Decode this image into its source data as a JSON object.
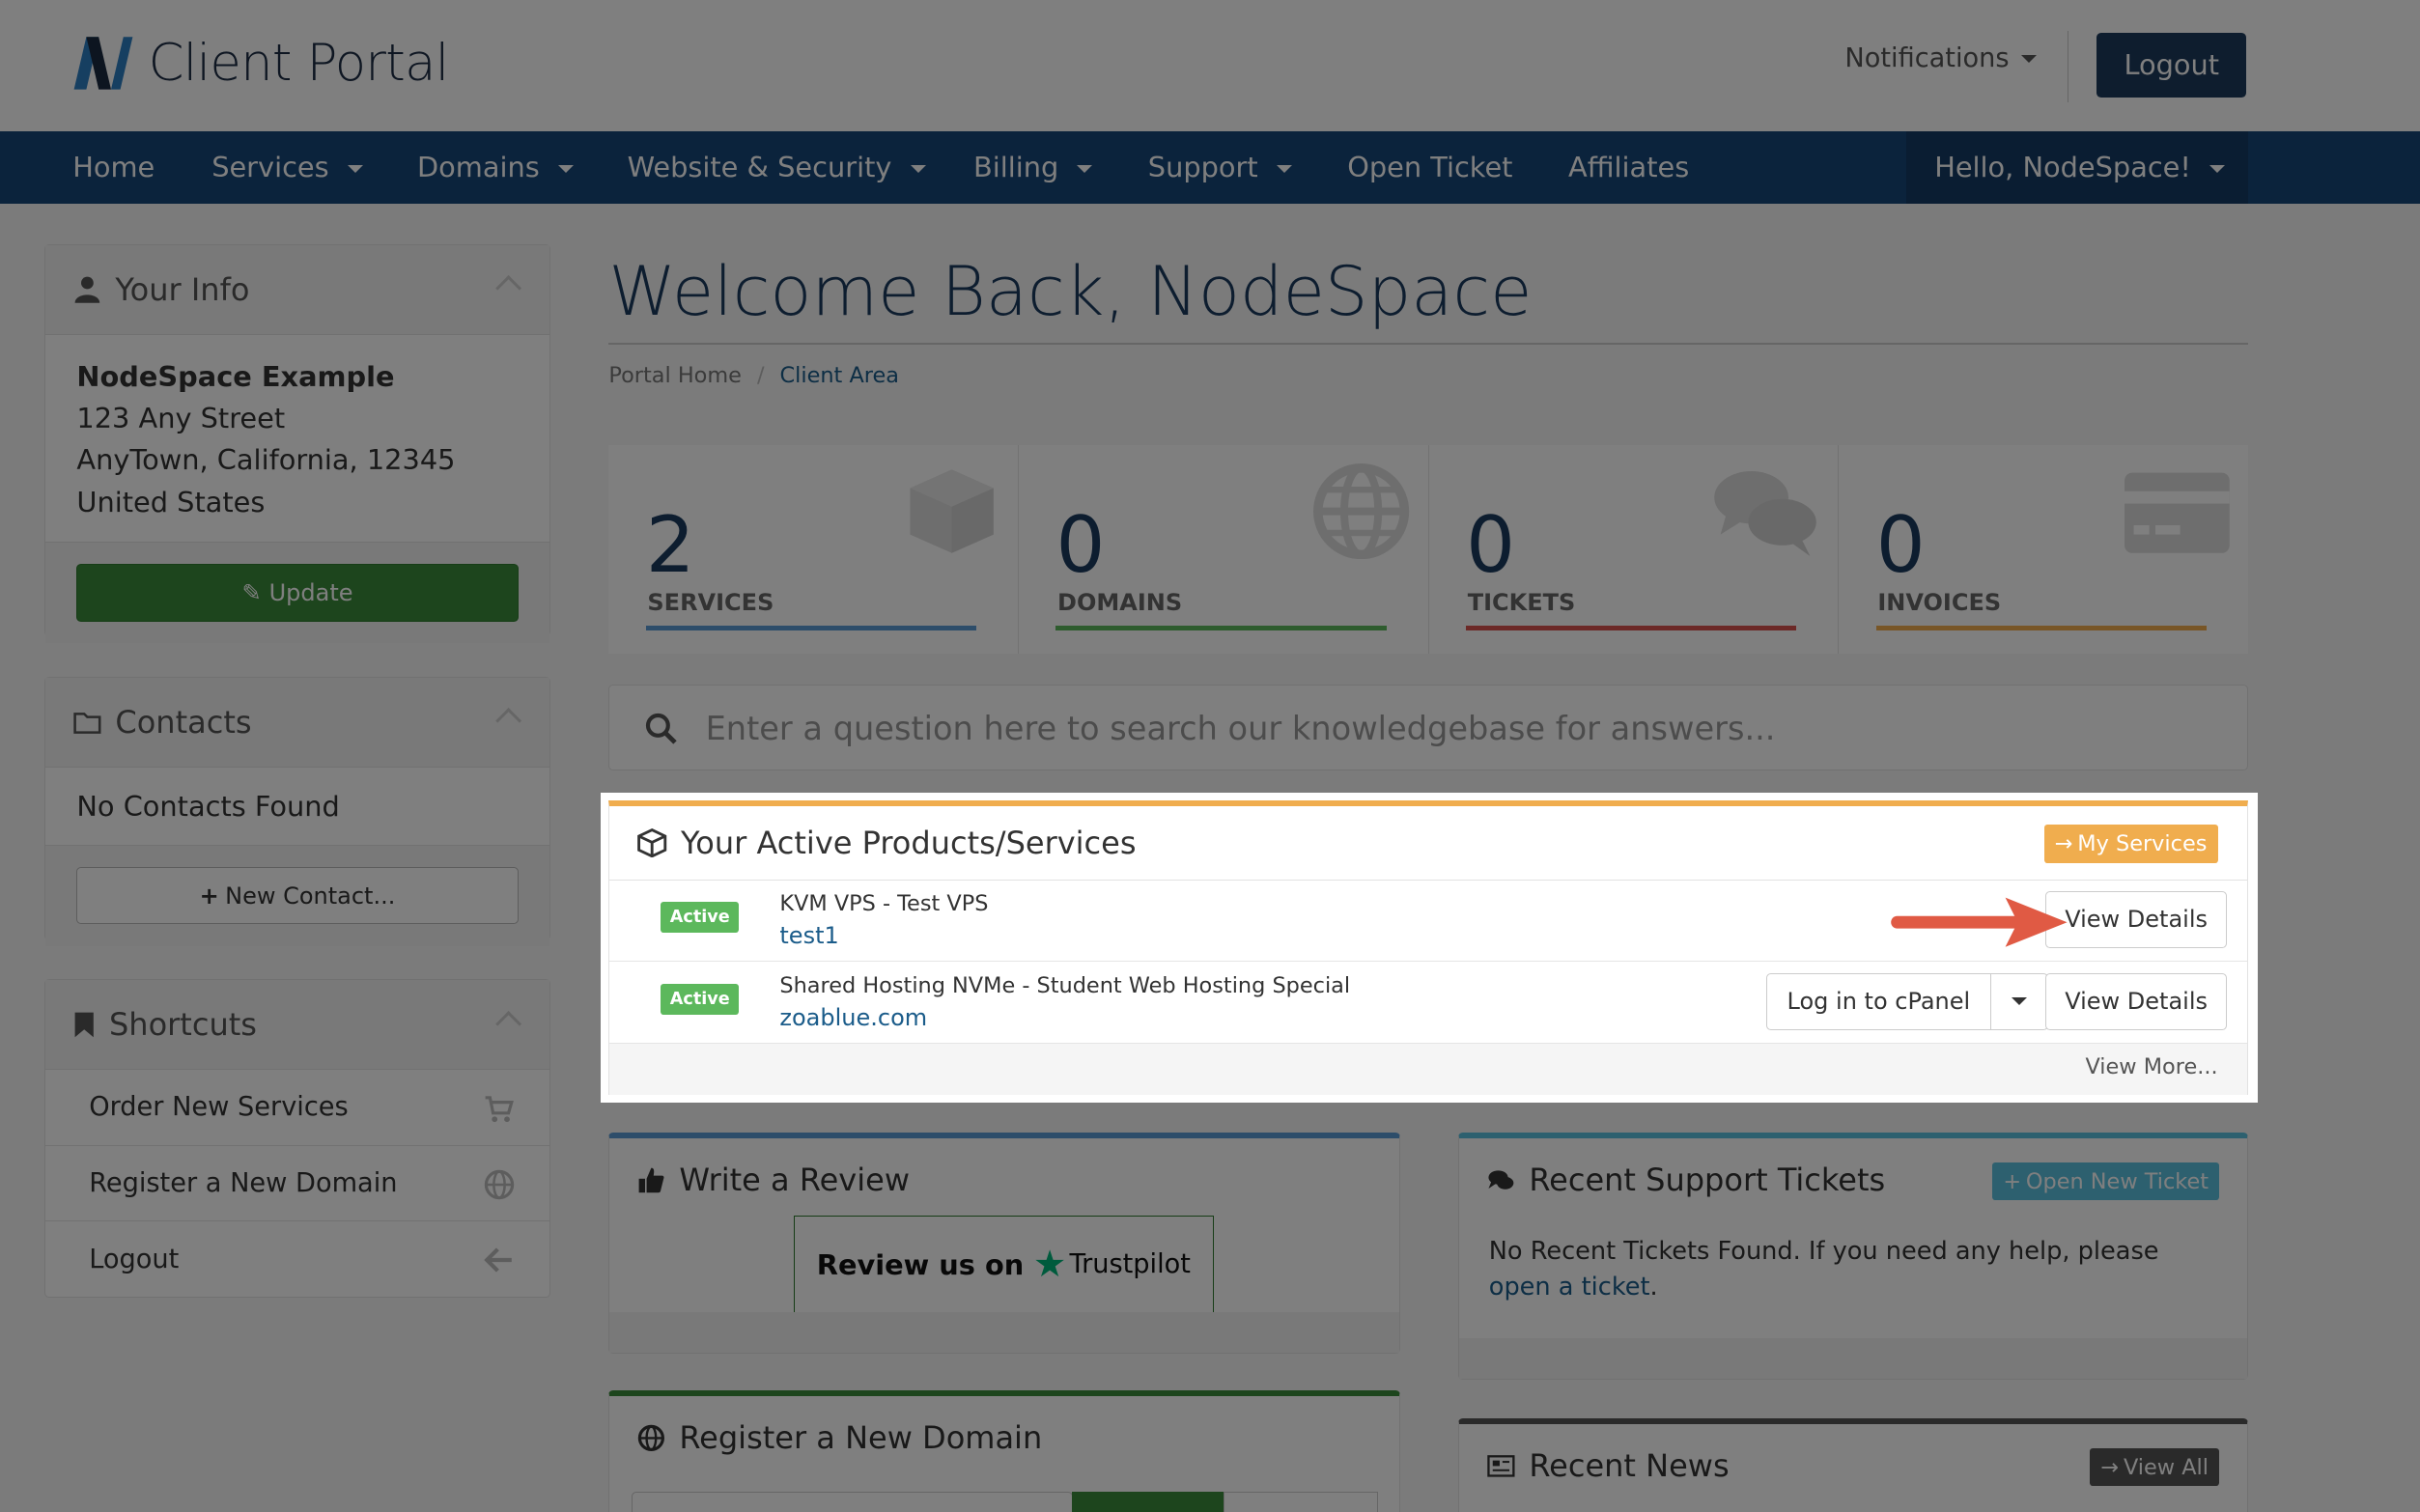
{
  "header": {
    "brand": "Client Portal",
    "notifications_label": "Notifications",
    "logout_label": "Logout"
  },
  "nav": {
    "items": [
      "Home",
      "Services",
      "Domains",
      "Website & Security",
      "Billing",
      "Support",
      "Open Ticket",
      "Affiliates"
    ],
    "user_greeting": "Hello, NodeSpace!"
  },
  "sidebar": {
    "your_info": {
      "title": "Your Info",
      "name": "NodeSpace Example",
      "street": "123 Any Street",
      "city_line": "AnyTown, California, 12345",
      "country": "United States",
      "update_label": "Update"
    },
    "contacts": {
      "title": "Contacts",
      "empty_text": "No Contacts Found",
      "new_contact_label": "New Contact..."
    },
    "shortcuts": {
      "title": "Shortcuts",
      "items": [
        "Order New Services",
        "Register a New Domain",
        "Logout"
      ]
    }
  },
  "main": {
    "welcome": "Welcome Back, NodeSpace",
    "breadcrumb": [
      "Portal Home",
      "Client Area"
    ],
    "stats": [
      {
        "value": "2",
        "label": "SERVICES",
        "color": "#5a9bd4"
      },
      {
        "value": "0",
        "label": "DOMAINS",
        "color": "#5cb85c"
      },
      {
        "value": "0",
        "label": "TICKETS",
        "color": "#d9534f"
      },
      {
        "value": "0",
        "label": "INVOICES",
        "color": "#f0ad4e"
      }
    ],
    "kb_search_placeholder": "Enter a question here to search our knowledgebase for answers...",
    "products": {
      "title": "Your Active Products/Services",
      "my_services_label": "My Services",
      "rows": [
        {
          "status": "Active",
          "name": "KVM VPS - Test VPS",
          "domain": "test1",
          "view_label": "View Details"
        },
        {
          "status": "Active",
          "name": "Shared Hosting NVMe - Student Web Hosting Special",
          "domain": "zoablue.com",
          "cpanel_label": "Log in to cPanel",
          "view_label": "View Details"
        }
      ],
      "view_more_label": "View More..."
    },
    "review": {
      "title": "Write a Review",
      "trustpilot_prefix": "Review us on",
      "trustpilot_brand": "Trustpilot"
    },
    "tickets": {
      "title": "Recent Support Tickets",
      "open_new_label": "Open New Ticket",
      "empty_text": "No Recent Tickets Found. If you need any help, please ",
      "link_text": "open a ticket",
      "end": "."
    },
    "register_domain": {
      "title": "Register a New Domain"
    },
    "news": {
      "title": "Recent News",
      "view_all_label": "View All"
    }
  },
  "colors": {
    "nav_bg": "#174679",
    "accent_orange": "#f0ad4e",
    "green": "#3a8a3a",
    "arrow": "#e05a44"
  }
}
